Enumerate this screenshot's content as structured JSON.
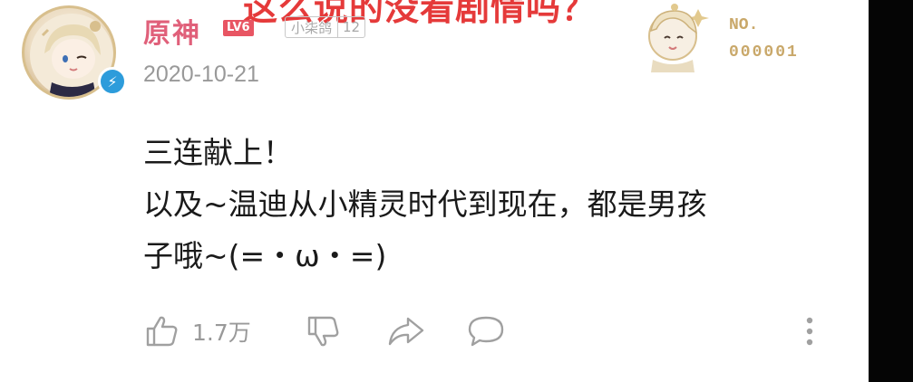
{
  "overlay": {
    "caption": "这么说的没看剧情吗？"
  },
  "user": {
    "name": "原神",
    "level_badge": "LV6",
    "fan_medal_name": "小柒鸽",
    "fan_medal_level": "12",
    "verified": true
  },
  "decoration": {
    "label": "NO.",
    "number": "000001"
  },
  "comment": {
    "date": "2020-10-21",
    "lines": [
      "三连献上！",
      "以及~温迪从小精灵时代到现在，都是男孩",
      "子哦~(=・ω・=)"
    ]
  },
  "actions": {
    "like_count": "1.7万",
    "icons": [
      "thumbs-up-icon",
      "thumbs-down-icon",
      "share-icon",
      "reply-icon",
      "more-icon"
    ]
  },
  "colors": {
    "username": "#e0607a",
    "level_badge": "#e85563",
    "verify_badge": "#2d9cdb",
    "overlay_caption": "#e53a3a",
    "muted": "#999999"
  }
}
